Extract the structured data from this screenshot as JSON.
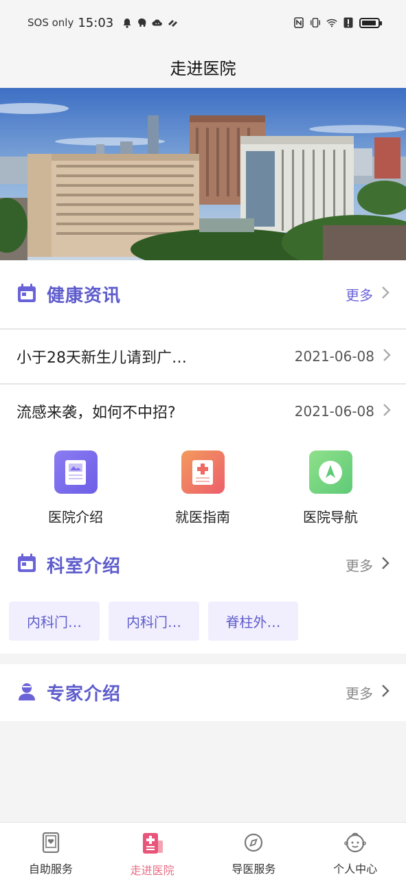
{
  "status_bar": {
    "carrier": "SOS only",
    "time": "15:03"
  },
  "header": {
    "title": "走进医院"
  },
  "banner": {
    "alt_icon": "hospital-photo"
  },
  "health_news": {
    "title": "健康资讯",
    "more": "更多",
    "items": [
      {
        "title": "小于28天新生儿请到广…",
        "date": "2021-06-08"
      },
      {
        "title": "流感来袭，如何不中招?",
        "date": "2021-06-08"
      }
    ]
  },
  "quick_actions": [
    {
      "label": "医院介绍",
      "icon": "document-image-icon",
      "color": "#7a6cf0"
    },
    {
      "label": "就医指南",
      "icon": "medical-guide-icon",
      "color": "#ef7560"
    },
    {
      "label": "医院导航",
      "icon": "navigation-icon",
      "color": "#6fd27f"
    }
  ],
  "departments": {
    "title": "科室介绍",
    "more": "更多",
    "items": [
      "内科门…",
      "内科门…",
      "脊柱外…"
    ]
  },
  "experts": {
    "title": "专家介绍",
    "more": "更多"
  },
  "tabbar": {
    "items": [
      {
        "label": "自助服务",
        "icon": "tablet-icon",
        "active": false
      },
      {
        "label": "走进医院",
        "icon": "hospital-icon",
        "active": true
      },
      {
        "label": "导医服务",
        "icon": "compass-icon",
        "active": false
      },
      {
        "label": "个人中心",
        "icon": "baby-face-icon",
        "active": false
      }
    ]
  },
  "colors": {
    "accent": "#5e5ccc",
    "active_tab": "#e86c84",
    "chip_bg": "#f1effd"
  }
}
